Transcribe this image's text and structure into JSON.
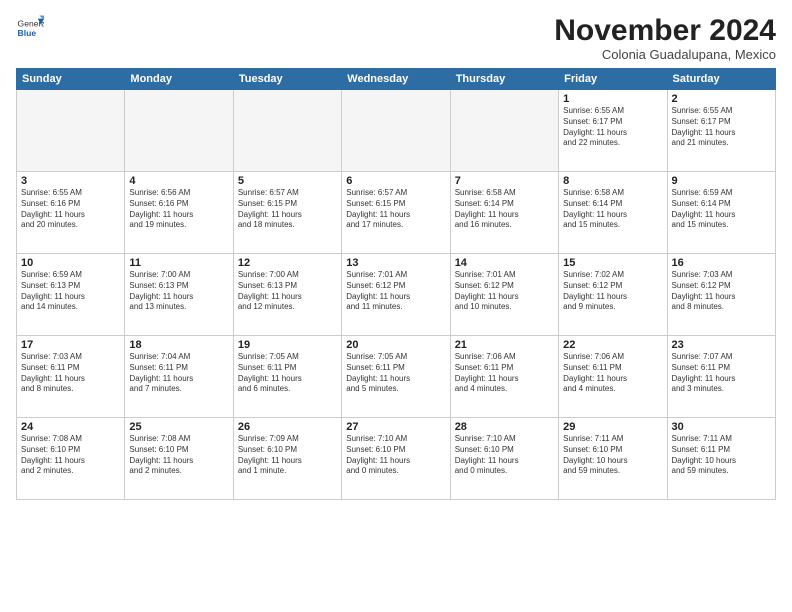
{
  "header": {
    "logo_general": "General",
    "logo_blue": "Blue",
    "title": "November 2024",
    "subtitle": "Colonia Guadalupana, Mexico"
  },
  "weekdays": [
    "Sunday",
    "Monday",
    "Tuesday",
    "Wednesday",
    "Thursday",
    "Friday",
    "Saturday"
  ],
  "weeks": [
    [
      {
        "day": "",
        "info": ""
      },
      {
        "day": "",
        "info": ""
      },
      {
        "day": "",
        "info": ""
      },
      {
        "day": "",
        "info": ""
      },
      {
        "day": "",
        "info": ""
      },
      {
        "day": "1",
        "info": "Sunrise: 6:55 AM\nSunset: 6:17 PM\nDaylight: 11 hours\nand 22 minutes."
      },
      {
        "day": "2",
        "info": "Sunrise: 6:55 AM\nSunset: 6:17 PM\nDaylight: 11 hours\nand 21 minutes."
      }
    ],
    [
      {
        "day": "3",
        "info": "Sunrise: 6:55 AM\nSunset: 6:16 PM\nDaylight: 11 hours\nand 20 minutes."
      },
      {
        "day": "4",
        "info": "Sunrise: 6:56 AM\nSunset: 6:16 PM\nDaylight: 11 hours\nand 19 minutes."
      },
      {
        "day": "5",
        "info": "Sunrise: 6:57 AM\nSunset: 6:15 PM\nDaylight: 11 hours\nand 18 minutes."
      },
      {
        "day": "6",
        "info": "Sunrise: 6:57 AM\nSunset: 6:15 PM\nDaylight: 11 hours\nand 17 minutes."
      },
      {
        "day": "7",
        "info": "Sunrise: 6:58 AM\nSunset: 6:14 PM\nDaylight: 11 hours\nand 16 minutes."
      },
      {
        "day": "8",
        "info": "Sunrise: 6:58 AM\nSunset: 6:14 PM\nDaylight: 11 hours\nand 15 minutes."
      },
      {
        "day": "9",
        "info": "Sunrise: 6:59 AM\nSunset: 6:14 PM\nDaylight: 11 hours\nand 15 minutes."
      }
    ],
    [
      {
        "day": "10",
        "info": "Sunrise: 6:59 AM\nSunset: 6:13 PM\nDaylight: 11 hours\nand 14 minutes."
      },
      {
        "day": "11",
        "info": "Sunrise: 7:00 AM\nSunset: 6:13 PM\nDaylight: 11 hours\nand 13 minutes."
      },
      {
        "day": "12",
        "info": "Sunrise: 7:00 AM\nSunset: 6:13 PM\nDaylight: 11 hours\nand 12 minutes."
      },
      {
        "day": "13",
        "info": "Sunrise: 7:01 AM\nSunset: 6:12 PM\nDaylight: 11 hours\nand 11 minutes."
      },
      {
        "day": "14",
        "info": "Sunrise: 7:01 AM\nSunset: 6:12 PM\nDaylight: 11 hours\nand 10 minutes."
      },
      {
        "day": "15",
        "info": "Sunrise: 7:02 AM\nSunset: 6:12 PM\nDaylight: 11 hours\nand 9 minutes."
      },
      {
        "day": "16",
        "info": "Sunrise: 7:03 AM\nSunset: 6:12 PM\nDaylight: 11 hours\nand 8 minutes."
      }
    ],
    [
      {
        "day": "17",
        "info": "Sunrise: 7:03 AM\nSunset: 6:11 PM\nDaylight: 11 hours\nand 8 minutes."
      },
      {
        "day": "18",
        "info": "Sunrise: 7:04 AM\nSunset: 6:11 PM\nDaylight: 11 hours\nand 7 minutes."
      },
      {
        "day": "19",
        "info": "Sunrise: 7:05 AM\nSunset: 6:11 PM\nDaylight: 11 hours\nand 6 minutes."
      },
      {
        "day": "20",
        "info": "Sunrise: 7:05 AM\nSunset: 6:11 PM\nDaylight: 11 hours\nand 5 minutes."
      },
      {
        "day": "21",
        "info": "Sunrise: 7:06 AM\nSunset: 6:11 PM\nDaylight: 11 hours\nand 4 minutes."
      },
      {
        "day": "22",
        "info": "Sunrise: 7:06 AM\nSunset: 6:11 PM\nDaylight: 11 hours\nand 4 minutes."
      },
      {
        "day": "23",
        "info": "Sunrise: 7:07 AM\nSunset: 6:11 PM\nDaylight: 11 hours\nand 3 minutes."
      }
    ],
    [
      {
        "day": "24",
        "info": "Sunrise: 7:08 AM\nSunset: 6:10 PM\nDaylight: 11 hours\nand 2 minutes."
      },
      {
        "day": "25",
        "info": "Sunrise: 7:08 AM\nSunset: 6:10 PM\nDaylight: 11 hours\nand 2 minutes."
      },
      {
        "day": "26",
        "info": "Sunrise: 7:09 AM\nSunset: 6:10 PM\nDaylight: 11 hours\nand 1 minute."
      },
      {
        "day": "27",
        "info": "Sunrise: 7:10 AM\nSunset: 6:10 PM\nDaylight: 11 hours\nand 0 minutes."
      },
      {
        "day": "28",
        "info": "Sunrise: 7:10 AM\nSunset: 6:10 PM\nDaylight: 11 hours\nand 0 minutes."
      },
      {
        "day": "29",
        "info": "Sunrise: 7:11 AM\nSunset: 6:10 PM\nDaylight: 10 hours\nand 59 minutes."
      },
      {
        "day": "30",
        "info": "Sunrise: 7:11 AM\nSunset: 6:11 PM\nDaylight: 10 hours\nand 59 minutes."
      }
    ]
  ]
}
